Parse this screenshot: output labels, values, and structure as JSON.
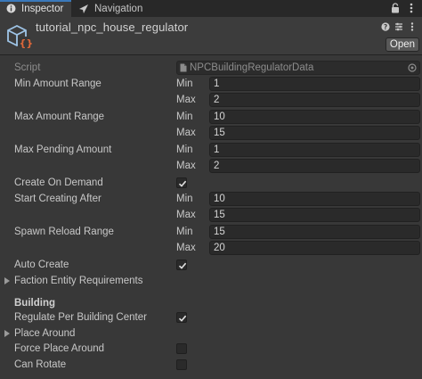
{
  "tabs": [
    {
      "label": "Inspector",
      "icon": "info-icon"
    },
    {
      "label": "Navigation",
      "icon": "navigation-icon"
    }
  ],
  "header": {
    "asset_name": "tutorial_npc_house_regulator",
    "open_label": "Open"
  },
  "script": {
    "label": "Script",
    "value": "NPCBuildingRegulatorData"
  },
  "range_labels": {
    "min": "Min",
    "max": "Max"
  },
  "properties": {
    "min_amount_range": {
      "label": "Min Amount Range",
      "min": "1",
      "max": "2"
    },
    "max_amount_range": {
      "label": "Max Amount Range",
      "min": "10",
      "max": "15"
    },
    "max_pending_amount": {
      "label": "Max Pending Amount",
      "min": "1",
      "max": "2"
    },
    "create_on_demand": {
      "label": "Create On Demand",
      "checked": true
    },
    "start_creating_after": {
      "label": "Start Creating After",
      "min": "10",
      "max": "15"
    },
    "spawn_reload_range": {
      "label": "Spawn Reload Range",
      "min": "15",
      "max": "20"
    },
    "auto_create": {
      "label": "Auto Create",
      "checked": true
    },
    "faction_entity_requirements": {
      "label": "Faction Entity Requirements"
    }
  },
  "building": {
    "header": "Building",
    "regulate_per_building_center": {
      "label": "Regulate Per Building Center",
      "checked": true
    },
    "place_around": {
      "label": "Place Around"
    },
    "force_place_around": {
      "label": "Force Place Around",
      "checked": false
    },
    "can_rotate": {
      "label": "Can Rotate",
      "checked": false
    }
  },
  "colors": {
    "panel_bg": "#383838",
    "tab_bg": "#282828",
    "field_bg": "#2a2a2a",
    "accent_tab": "#3a79bb",
    "text": "#c8c8c8"
  }
}
